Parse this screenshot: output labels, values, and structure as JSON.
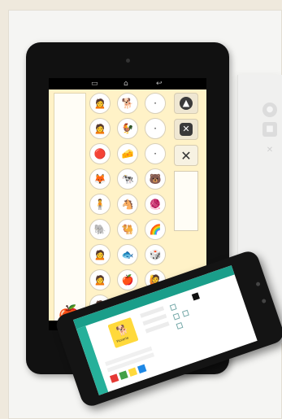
{
  "background_color": "#efe9dd",
  "ghost_panel": {
    "icons": [
      "circle-icon",
      "shield-icon",
      "close-icon"
    ]
  },
  "tablet_main": {
    "screen_color": "#fff2c7",
    "nav_icons": [
      "back-icon",
      "home-icon",
      "recent-apps-icon"
    ],
    "symbol_grid": [
      [
        "🙍",
        "🐕",
        "·"
      ],
      [
        "🙍",
        "🐓",
        "·"
      ],
      [
        "🔴",
        "🧀",
        "·"
      ],
      [
        "🦊",
        "🐄",
        "🐻"
      ],
      [
        "🧍",
        "🐴",
        "🧶"
      ],
      [
        "🐘",
        "🐫",
        "🌈"
      ],
      [
        "🙍",
        "🐟",
        "🎲"
      ],
      [
        "🙍",
        "🍎",
        "🙋"
      ],
      [
        "🙍",
        "🦆",
        "🐦"
      ]
    ],
    "controls": [
      {
        "name": "up-arrow-button",
        "glyph": "▲"
      },
      {
        "name": "delete-word-button",
        "glyph": "✕"
      },
      {
        "name": "clear-button",
        "glyph": "✕"
      }
    ],
    "help_glyph": "?",
    "sentence_symbol": "🍎"
  },
  "tablet_second": {
    "accent": "#1a9e8a",
    "tile_glyph": "🐕",
    "tile_text": "Pizzeria",
    "color_chips": [
      "#e53935",
      "#43a047",
      "#ffd93b",
      "#1e88e5"
    ]
  }
}
